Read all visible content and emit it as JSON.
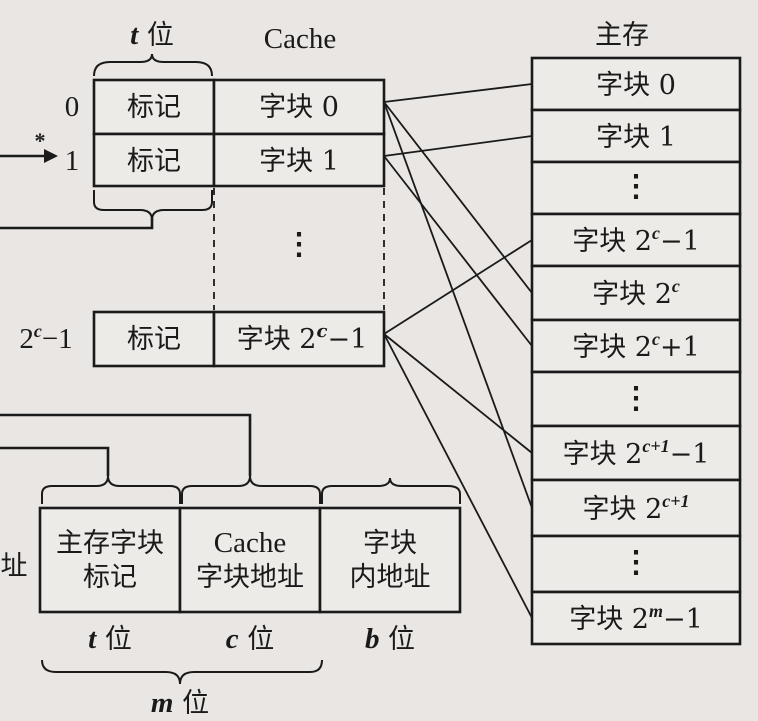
{
  "cache": {
    "header": "Cache",
    "tag_width": "t 位",
    "lines": [
      {
        "index": "0",
        "tag": "标记",
        "block": "字块 0"
      },
      {
        "index": "1",
        "tag": "标记",
        "block": "字块 1"
      },
      {
        "index": "2c−1",
        "tag": "标记",
        "block": "字块 2c−1"
      }
    ],
    "pointer_mark": "*",
    "ellipsis": "⋮"
  },
  "main_memory": {
    "header": "主存",
    "blocks": [
      "字块 0",
      "字块 1",
      "⋮",
      "字块 2c−1",
      "字块 2c",
      "字块 2c+1",
      "⋮",
      "字块 2c+1−1",
      "字块 2c+1",
      "⋮",
      "字块 2m−1"
    ]
  },
  "address": {
    "left_cut_label": "址",
    "fields": [
      {
        "line1": "主存字块",
        "line2": "标记",
        "width": "t 位"
      },
      {
        "line1": "Cache",
        "line2": "字块地址",
        "width": "c 位"
      },
      {
        "line1": "字块",
        "line2": "内地址",
        "width": "b 位"
      }
    ],
    "total": "m 位"
  }
}
